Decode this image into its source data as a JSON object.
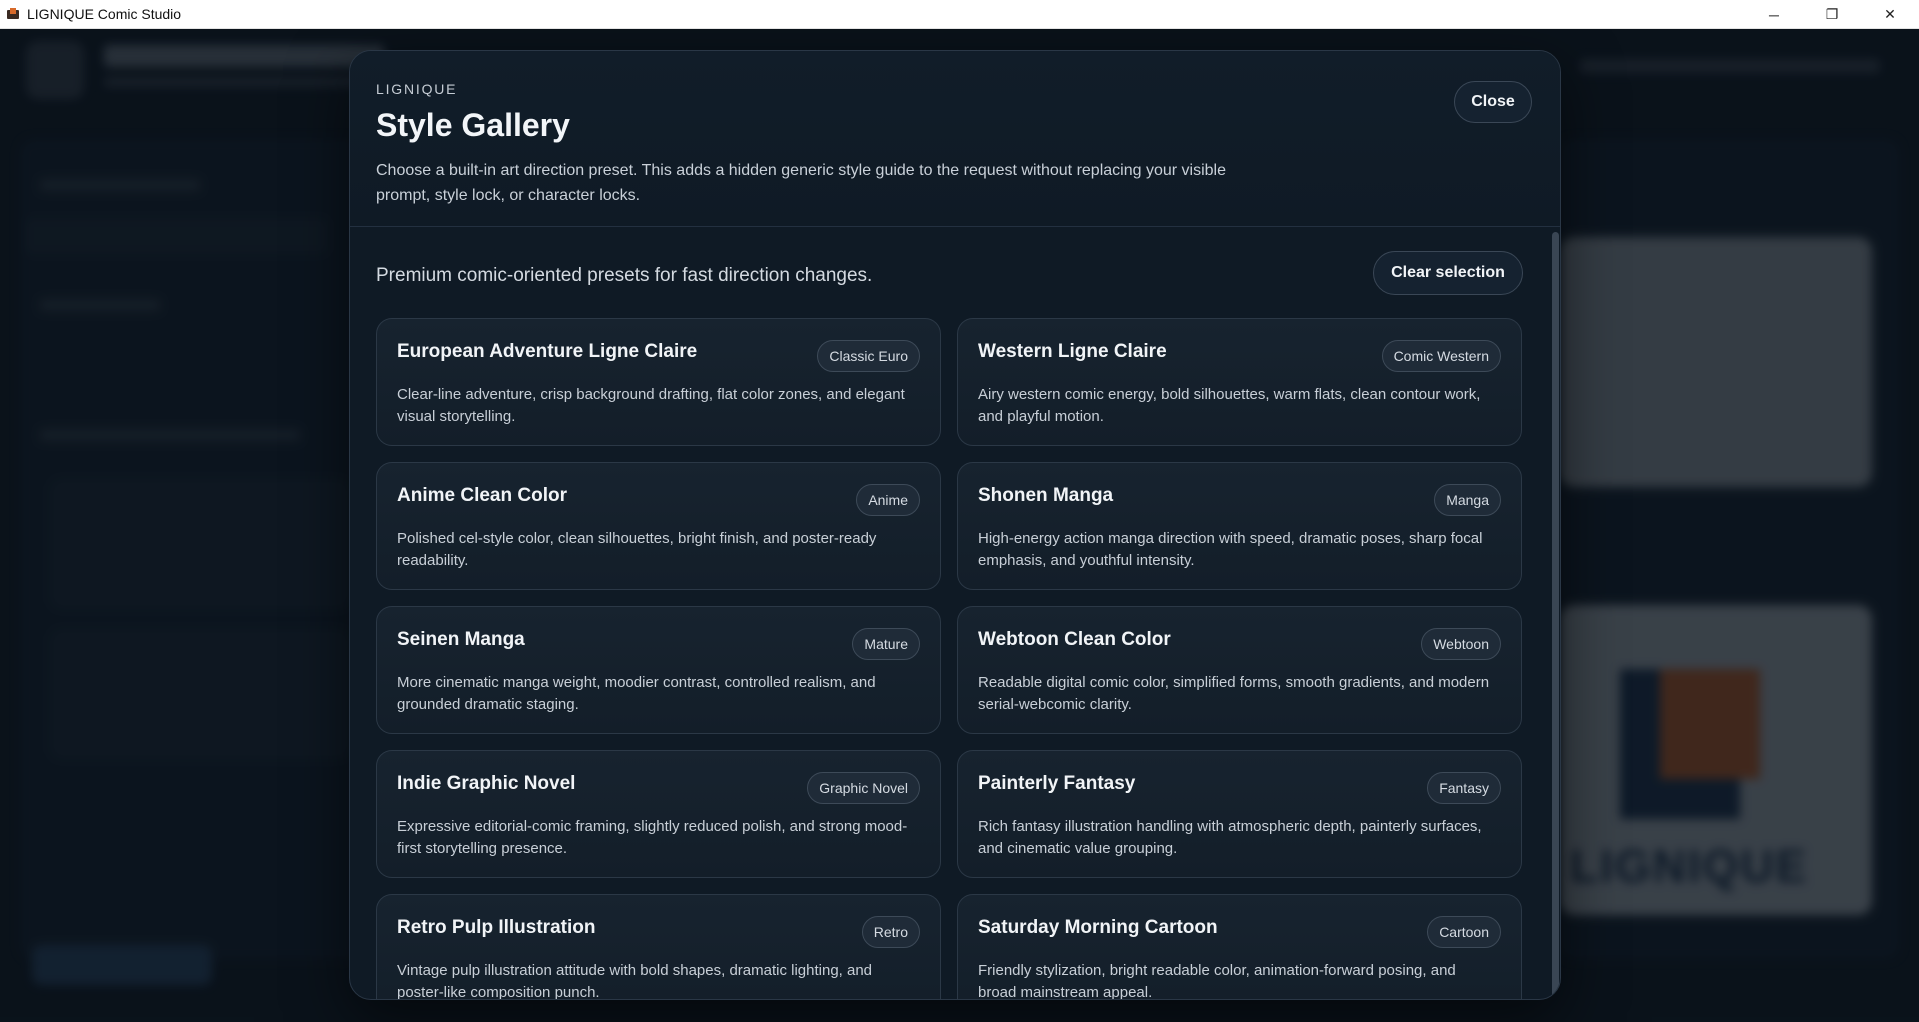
{
  "window": {
    "title": "LIGNIQUE Comic Studio",
    "controls": {
      "minimize": "─",
      "maximize": "❐",
      "close": "✕"
    }
  },
  "modal": {
    "eyebrow": "LIGNIQUE",
    "title": "Style Gallery",
    "description": "Choose a built-in art direction preset. This adds a hidden generic style guide to the request without replacing your visible prompt, style lock, or character locks.",
    "close_label": "Close",
    "intro": "Premium comic-oriented presets for fast direction changes.",
    "clear_label": "Clear selection",
    "presets": [
      {
        "name": "European Adventure Ligne Claire",
        "tag": "Classic Euro",
        "description": "Clear-line adventure, crisp background drafting, flat color zones, and elegant visual storytelling."
      },
      {
        "name": "Western Ligne Claire",
        "tag": "Comic Western",
        "description": "Airy western comic energy, bold silhouettes, warm flats, clean contour work, and playful motion."
      },
      {
        "name": "Anime Clean Color",
        "tag": "Anime",
        "description": "Polished cel-style color, clean silhouettes, bright finish, and poster-ready readability."
      },
      {
        "name": "Shonen Manga",
        "tag": "Manga",
        "description": "High-energy action manga direction with speed, dramatic poses, sharp focal emphasis, and youthful intensity."
      },
      {
        "name": "Seinen Manga",
        "tag": "Mature",
        "description": "More cinematic manga weight, moodier contrast, controlled realism, and grounded dramatic staging."
      },
      {
        "name": "Webtoon Clean Color",
        "tag": "Webtoon",
        "description": "Readable digital comic color, simplified forms, smooth gradients, and modern serial-webcomic clarity."
      },
      {
        "name": "Indie Graphic Novel",
        "tag": "Graphic Novel",
        "description": "Expressive editorial-comic framing, slightly reduced polish, and strong mood-first storytelling presence."
      },
      {
        "name": "Painterly Fantasy",
        "tag": "Fantasy",
        "description": "Rich fantasy illustration handling with atmospheric depth, painterly surfaces, and cinematic value grouping."
      },
      {
        "name": "Retro Pulp Illustration",
        "tag": "Retro",
        "description": "Vintage pulp illustration attitude with bold shapes, dramatic lighting, and poster-like composition punch."
      },
      {
        "name": "Saturday Morning Cartoon",
        "tag": "Cartoon",
        "description": "Friendly stylization, bright readable color, animation-forward posing, and broad mainstream appeal."
      }
    ]
  },
  "background": {
    "brand_watermark": "LIGNIQUE"
  }
}
